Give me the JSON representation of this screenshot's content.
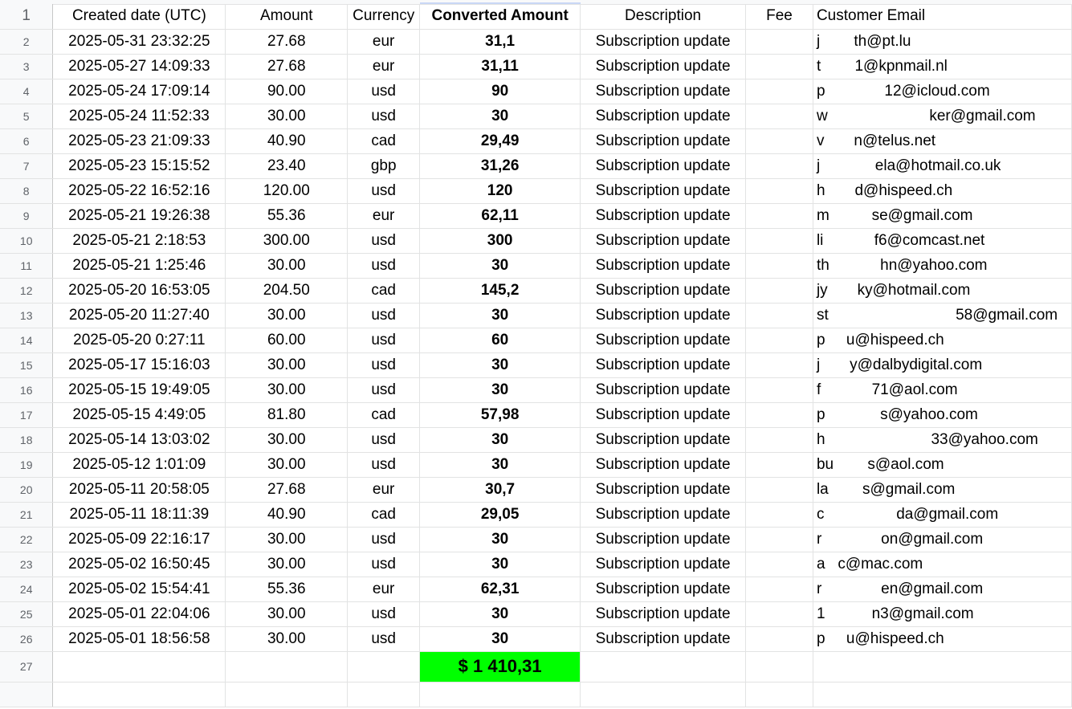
{
  "header": {
    "row_number": "1",
    "created_date": "Created date (UTC)",
    "amount": "Amount",
    "currency": "Currency",
    "converted_amount": "Converted Amount",
    "description": "Description",
    "fee": "Fee",
    "customer_email": "Customer Email"
  },
  "rows": [
    {
      "n": "2",
      "date": "2025-05-31 23:32:25",
      "amount": "27.68",
      "currency": "eur",
      "converted": "31,1",
      "desc": "Subscription update",
      "email": "j        th@pt.lu"
    },
    {
      "n": "3",
      "date": "2025-05-27 14:09:33",
      "amount": "27.68",
      "currency": "eur",
      "converted": "31,11",
      "desc": "Subscription update",
      "email": "t        1@kpnmail.nl"
    },
    {
      "n": "4",
      "date": "2025-05-24 17:09:14",
      "amount": "90.00",
      "currency": "usd",
      "converted": "90",
      "desc": "Subscription update",
      "email": "p              12@icloud.com"
    },
    {
      "n": "5",
      "date": "2025-05-24 11:52:33",
      "amount": "30.00",
      "currency": "usd",
      "converted": "30",
      "desc": "Subscription update",
      "email": "w                        ker@gmail.com"
    },
    {
      "n": "6",
      "date": "2025-05-23 21:09:33",
      "amount": "40.90",
      "currency": "cad",
      "converted": "29,49",
      "desc": "Subscription update",
      "email": "v       n@telus.net"
    },
    {
      "n": "7",
      "date": "2025-05-23 15:15:52",
      "amount": "23.40",
      "currency": "gbp",
      "converted": "31,26",
      "desc": "Subscription update",
      "email": "j             ela@hotmail.co.uk"
    },
    {
      "n": "8",
      "date": "2025-05-22 16:52:16",
      "amount": "120.00",
      "currency": "usd",
      "converted": "120",
      "desc": "Subscription update",
      "email": "h       d@hispeed.ch"
    },
    {
      "n": "9",
      "date": "2025-05-21 19:26:38",
      "amount": "55.36",
      "currency": "eur",
      "converted": "62,11",
      "desc": "Subscription update",
      "email": "m          se@gmail.com"
    },
    {
      "n": "10",
      "date": "2025-05-21 2:18:53",
      "amount": "300.00",
      "currency": "usd",
      "converted": "300",
      "desc": "Subscription update",
      "email": "li            f6@comcast.net"
    },
    {
      "n": "11",
      "date": "2025-05-21 1:25:46",
      "amount": "30.00",
      "currency": "usd",
      "converted": "30",
      "desc": "Subscription update",
      "email": "th            hn@yahoo.com"
    },
    {
      "n": "12",
      "date": "2025-05-20 16:53:05",
      "amount": "204.50",
      "currency": "cad",
      "converted": "145,2",
      "desc": "Subscription update",
      "email": "jy       ky@hotmail.com"
    },
    {
      "n": "13",
      "date": "2025-05-20 11:27:40",
      "amount": "30.00",
      "currency": "usd",
      "converted": "30",
      "desc": "Subscription update",
      "email": "st                              58@gmail.com"
    },
    {
      "n": "14",
      "date": "2025-05-20 0:27:11",
      "amount": "60.00",
      "currency": "usd",
      "converted": "60",
      "desc": "Subscription update",
      "email": "p     u@hispeed.ch"
    },
    {
      "n": "15",
      "date": "2025-05-17 15:16:03",
      "amount": "30.00",
      "currency": "usd",
      "converted": "30",
      "desc": "Subscription update",
      "email": "j       y@dalbydigital.com"
    },
    {
      "n": "16",
      "date": "2025-05-15 19:49:05",
      "amount": "30.00",
      "currency": "usd",
      "converted": "30",
      "desc": "Subscription update",
      "email": "f            71@aol.com"
    },
    {
      "n": "17",
      "date": "2025-05-15 4:49:05",
      "amount": "81.80",
      "currency": "cad",
      "converted": "57,98",
      "desc": "Subscription update",
      "email": "p             s@yahoo.com"
    },
    {
      "n": "18",
      "date": "2025-05-14 13:03:02",
      "amount": "30.00",
      "currency": "usd",
      "converted": "30",
      "desc": "Subscription update",
      "email": "h                         33@yahoo.com"
    },
    {
      "n": "19",
      "date": "2025-05-12 1:01:09",
      "amount": "30.00",
      "currency": "usd",
      "converted": "30",
      "desc": "Subscription update",
      "email": "bu        s@aol.com"
    },
    {
      "n": "20",
      "date": "2025-05-11 20:58:05",
      "amount": "27.68",
      "currency": "eur",
      "converted": "30,7",
      "desc": "Subscription update",
      "email": "la        s@gmail.com"
    },
    {
      "n": "21",
      "date": "2025-05-11 18:11:39",
      "amount": "40.90",
      "currency": "cad",
      "converted": "29,05",
      "desc": "Subscription update",
      "email": "c                 da@gmail.com"
    },
    {
      "n": "22",
      "date": "2025-05-09 22:16:17",
      "amount": "30.00",
      "currency": "usd",
      "converted": "30",
      "desc": "Subscription update",
      "email": "r              on@gmail.com"
    },
    {
      "n": "23",
      "date": "2025-05-02 16:50:45",
      "amount": "30.00",
      "currency": "usd",
      "converted": "30",
      "desc": "Subscription update",
      "email": "a   c@mac.com"
    },
    {
      "n": "24",
      "date": "2025-05-02 15:54:41",
      "amount": "55.36",
      "currency": "eur",
      "converted": "62,31",
      "desc": "Subscription update",
      "email": "r              en@gmail.com"
    },
    {
      "n": "25",
      "date": "2025-05-01 22:04:06",
      "amount": "30.00",
      "currency": "usd",
      "converted": "30",
      "desc": "Subscription update",
      "email": "1           n3@gmail.com"
    },
    {
      "n": "26",
      "date": "2025-05-01 18:56:58",
      "amount": "30.00",
      "currency": "usd",
      "converted": "30",
      "desc": "Subscription update",
      "email": "p     u@hispeed.ch"
    }
  ],
  "total_row": {
    "n": "27",
    "total": "$ 1 410,31"
  },
  "colors": {
    "total_highlight": "#00ff00",
    "gridline": "#e2e3e3",
    "row_header_bg": "#f8f9fa"
  }
}
